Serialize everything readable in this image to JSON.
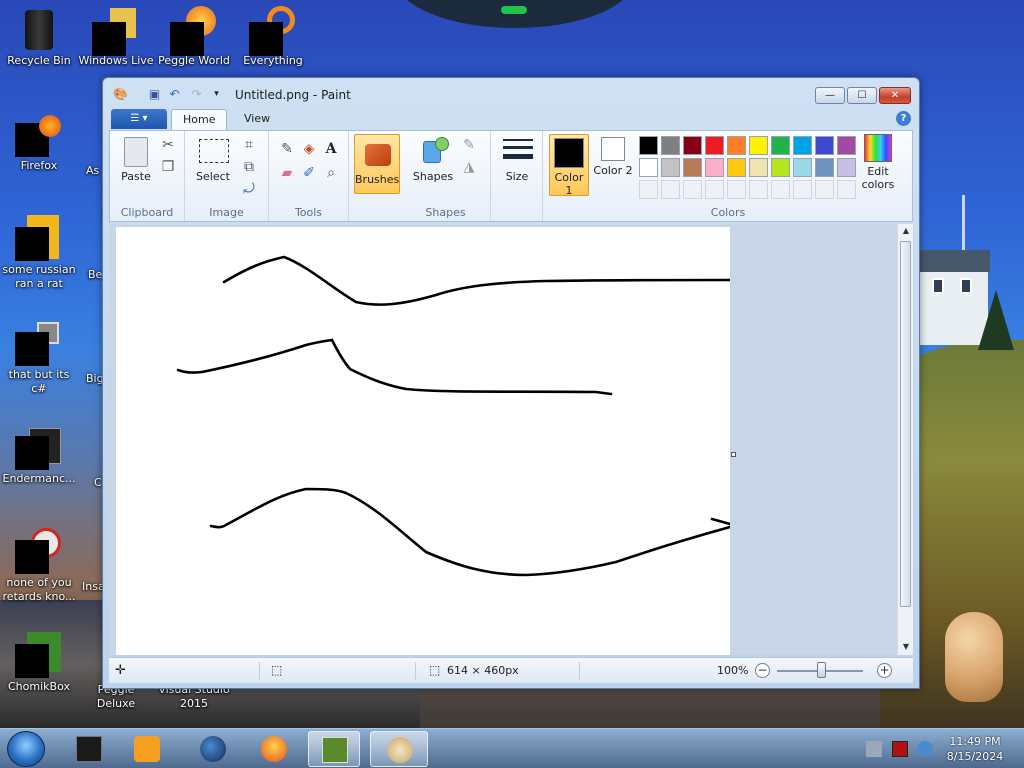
{
  "desktop": {
    "icons": [
      {
        "label": "Recycle Bin"
      },
      {
        "label": "Windows Live"
      },
      {
        "label": "Peggle World"
      },
      {
        "label": "Everything"
      },
      {
        "label": "Firefox"
      },
      {
        "label": "some russian ran a rat"
      },
      {
        "label": "that but its c#"
      },
      {
        "label": "Endermanc..."
      },
      {
        "label": "none of you retards kno..."
      },
      {
        "label": "ChomikBox"
      },
      {
        "label": "Peggle Deluxe"
      },
      {
        "label": "Visual Studio 2015"
      }
    ],
    "partial_icons": [
      {
        "label": "As"
      },
      {
        "label": "Be"
      },
      {
        "label": "Big"
      },
      {
        "label": "C"
      },
      {
        "label": "Insa"
      }
    ]
  },
  "window": {
    "title": "Untitled.png - Paint",
    "controls": {
      "minimize": "—",
      "maximize": "☐",
      "close": "✕"
    }
  },
  "ribbon": {
    "tabs": [
      {
        "label": "Home"
      },
      {
        "label": "View"
      }
    ],
    "groups": {
      "clipboard": {
        "label": "Clipboard",
        "paste": "Paste"
      },
      "image": {
        "label": "Image",
        "select": "Select"
      },
      "tools": {
        "label": "Tools"
      },
      "brushes": {
        "label": "Brushes"
      },
      "shapes": {
        "label": "Shapes",
        "shapes_btn": "Shapes"
      },
      "size": {
        "label": "Size"
      },
      "colors": {
        "label": "Colors",
        "color1": "Color 1",
        "color2": "Color 2",
        "edit_colors": "Edit colors",
        "color1_value": "#000000",
        "color2_value": "#ffffff",
        "palette_row1": [
          "#000000",
          "#7f7f7f",
          "#880015",
          "#ed1c24",
          "#ff7f27",
          "#fff200",
          "#22b14c",
          "#00a2e8",
          "#3f48cc",
          "#a349a4"
        ],
        "palette_row2": [
          "#ffffff",
          "#c3c3c3",
          "#b97a57",
          "#ffaec9",
          "#ffc90e",
          "#efe4b0",
          "#b5e61d",
          "#99d9ea",
          "#7092be",
          "#c8bfe7"
        ]
      }
    }
  },
  "status": {
    "image_size": "614 × 460px",
    "zoom": "100%",
    "zoom_out": "−",
    "zoom_in": "+"
  },
  "taskbar": {
    "time": "11:49 PM",
    "date": "8/15/2024"
  }
}
